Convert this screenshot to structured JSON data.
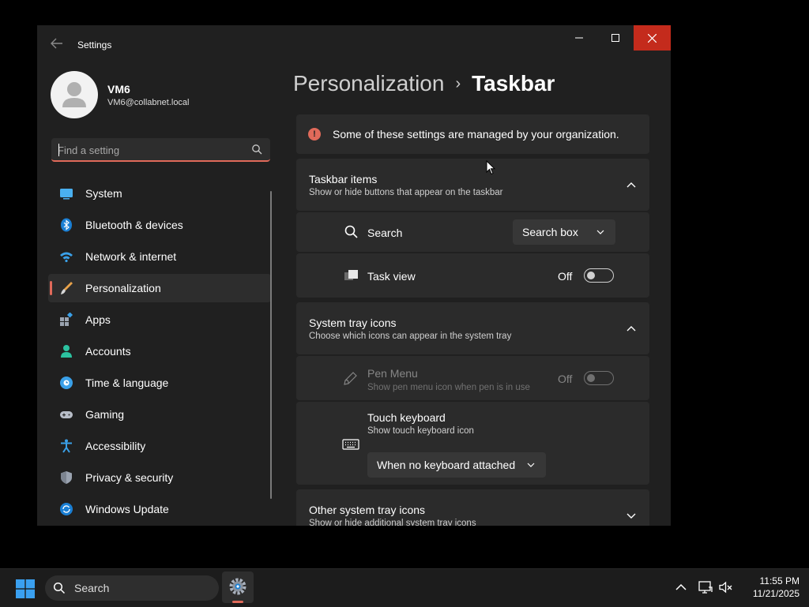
{
  "window": {
    "app_title": "Settings",
    "back_icon": "back-arrow-icon",
    "controls": {
      "minimize_icon": "minimize-icon",
      "maximize_icon": "maximize-icon",
      "close_icon": "close-icon",
      "close_color": "#c42b1c"
    }
  },
  "user": {
    "name": "VM6",
    "email": "VM6@collabnet.local"
  },
  "search": {
    "placeholder": "Find a setting",
    "value": ""
  },
  "sidebar": {
    "items": [
      {
        "label": "System",
        "icon": "system-icon",
        "active": false
      },
      {
        "label": "Bluetooth & devices",
        "icon": "bluetooth-icon",
        "active": false
      },
      {
        "label": "Network & internet",
        "icon": "wifi-icon",
        "active": false
      },
      {
        "label": "Personalization",
        "icon": "brush-icon",
        "active": true
      },
      {
        "label": "Apps",
        "icon": "apps-icon",
        "active": false
      },
      {
        "label": "Accounts",
        "icon": "accounts-icon",
        "active": false
      },
      {
        "label": "Time & language",
        "icon": "globe-clock-icon",
        "active": false
      },
      {
        "label": "Gaming",
        "icon": "gamepad-icon",
        "active": false
      },
      {
        "label": "Accessibility",
        "icon": "accessibility-icon",
        "active": false
      },
      {
        "label": "Privacy & security",
        "icon": "shield-icon",
        "active": false
      },
      {
        "label": "Windows Update",
        "icon": "update-icon",
        "active": false
      }
    ],
    "accent": "#e06a5a"
  },
  "breadcrumb": {
    "parent": "Personalization",
    "separator": "›",
    "current": "Taskbar"
  },
  "notice": {
    "text": "Some of these settings are managed by your organization.",
    "icon": "!"
  },
  "taskbar_items": {
    "title": "Taskbar items",
    "subtitle": "Show or hide buttons that appear on the taskbar",
    "expanded": true,
    "rows": {
      "search": {
        "label": "Search",
        "value": "Search box"
      },
      "task_view": {
        "label": "Task view",
        "state": "Off"
      }
    }
  },
  "system_tray_icons": {
    "title": "System tray icons",
    "subtitle": "Choose which icons can appear in the system tray",
    "expanded": true,
    "rows": {
      "pen_menu": {
        "label": "Pen Menu",
        "sub": "Show pen menu icon when pen is in use",
        "state": "Off",
        "disabled": true
      },
      "touch_keyboard": {
        "label": "Touch keyboard",
        "sub": "Show touch keyboard icon",
        "value": "When no keyboard attached"
      }
    }
  },
  "other_tray_icons": {
    "title": "Other system tray icons",
    "subtitle": "Show or hide additional system tray icons",
    "expanded": false
  },
  "os_taskbar": {
    "search_label": "Search",
    "time": "11:55 PM",
    "date": "11/21/2025",
    "tray_icons": [
      "chevron-up-icon",
      "display-icon",
      "speaker-muted-icon"
    ]
  }
}
